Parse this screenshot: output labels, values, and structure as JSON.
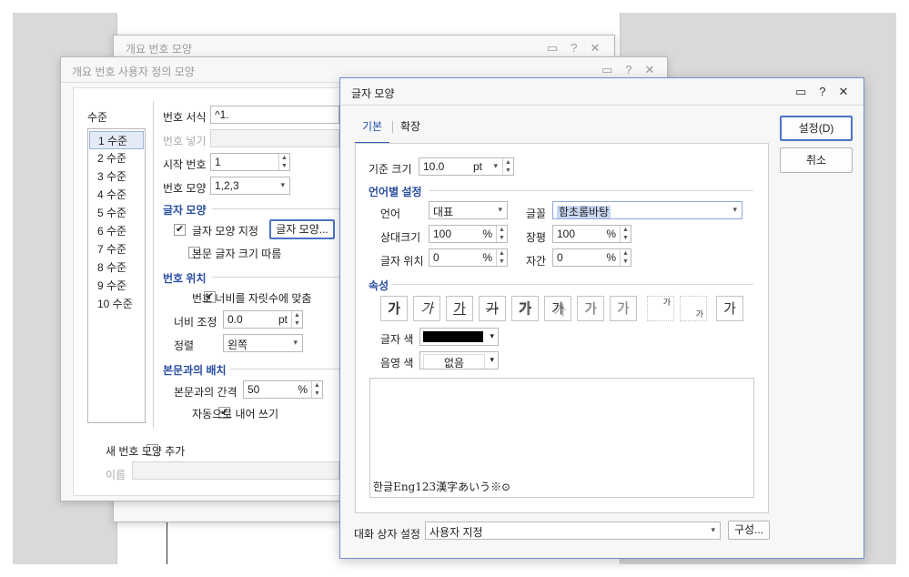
{
  "back_dialog": {
    "title": "개요 번호 모양"
  },
  "outline_dialog": {
    "title": "개요 번호 사용자 정의 모양",
    "level_header": "수준",
    "levels": [
      "1 수준",
      "2 수준",
      "3 수준",
      "4 수준",
      "5 수준",
      "6 수준",
      "7 수준",
      "8 수준",
      "9 수준",
      "10 수준"
    ],
    "selected_level": "1 수준",
    "number_format_label": "번호 서식",
    "number_format_value": "^1.",
    "number_insert_label": "번호 넣기",
    "start_number_label": "시작 번호",
    "start_number_value": "1",
    "number_shape_label": "번호 모양",
    "number_shape_value": "1,2,3",
    "char_shape_section": "글자 모양",
    "char_shape_specify_label": "글자 모양 지정",
    "char_shape_button": "글자 모양...",
    "follow_body_size_label": "본문 글자 크기 따름",
    "number_position_section": "번호 위치",
    "fit_width_label": "번호 너비를 자릿수에 맞춤",
    "width_adjust_label": "너비 조정",
    "width_adjust_value": "0.0",
    "width_adjust_unit": "pt",
    "align_label": "정렬",
    "align_value": "왼쪽",
    "body_layout_section": "본문과의 배치",
    "gap_label": "본문과의 간격",
    "gap_value": "50",
    "gap_unit": "%",
    "auto_indent_label": "자동으로 내어 쓰기",
    "add_shape_label": "새 번호 모양 추가",
    "name_label": "이름"
  },
  "char_dialog": {
    "title": "글자 모양",
    "tabs": [
      "기본",
      "확장"
    ],
    "base_size_label": "기준 크기",
    "base_size_value": "10.0",
    "base_size_unit": "pt",
    "lang_section": "언어별 설정",
    "lang_label": "언어",
    "lang_value": "대표",
    "font_label": "글꼴",
    "font_value": "함초롬바탕",
    "rel_size_label": "상대크기",
    "rel_size_value": "100",
    "width_ratio_label": "장평",
    "width_ratio_value": "100",
    "position_label": "글자 위치",
    "position_value": "0",
    "spacing_label": "자간",
    "spacing_value": "0",
    "percent": "%",
    "attr_section": "속성",
    "attr_buttons": [
      {
        "glyph": "가",
        "name": "bold-icon"
      },
      {
        "glyph": "가",
        "name": "italic-icon"
      },
      {
        "glyph": "가",
        "name": "underline-icon"
      },
      {
        "glyph": "가",
        "name": "strikethrough-icon"
      },
      {
        "glyph": "가",
        "name": "outline-icon"
      },
      {
        "glyph": "가",
        "name": "shadow-icon"
      },
      {
        "glyph": "가",
        "name": "emboss-icon"
      },
      {
        "glyph": "가",
        "name": "engrave-icon"
      },
      {
        "glyph": "가",
        "name": "superscript-icon"
      },
      {
        "glyph": "가",
        "name": "subscript-icon"
      },
      {
        "glyph": "가",
        "name": "normal-icon"
      }
    ],
    "text_color_label": "글자 색",
    "text_color": "#000000",
    "shade_color_label": "음영 색",
    "shade_color_value": "없음",
    "preview_text": "한글Eng123漢字あいう※⊙",
    "dialog_setting_label": "대화 상자 설정",
    "dialog_setting_value": "사용자 지정",
    "config_button": "구성...",
    "ok_button": "설정(D)",
    "cancel_button": "취소"
  },
  "colors": {
    "accent": "#2d60c4",
    "section": "#2a4ea0"
  }
}
